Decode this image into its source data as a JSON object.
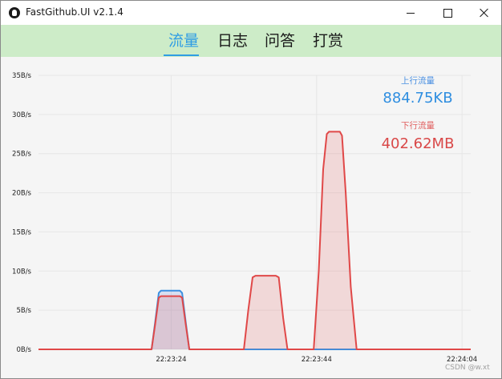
{
  "window": {
    "title": "FastGithub.UI v2.1.4",
    "controls": [
      "minimize",
      "maximize",
      "close"
    ]
  },
  "tabs": [
    {
      "label": "流量",
      "active": true
    },
    {
      "label": "日志",
      "active": false
    },
    {
      "label": "问答",
      "active": false
    },
    {
      "label": "打赏",
      "active": false
    }
  ],
  "stats": {
    "upload_label": "上行流量",
    "upload_value": "884.75KB",
    "download_label": "下行流量",
    "download_value": "402.62MB"
  },
  "colors": {
    "tab_bar": "#cdecc8",
    "active_tab": "#2f9de4",
    "upload": "#3b8fe0",
    "download": "#e04848"
  },
  "chart_data": {
    "type": "area",
    "y_ticks": [
      "0B/s",
      "5B/s",
      "10B/s",
      "15B/s",
      "20B/s",
      "25B/s",
      "30B/s",
      "35B/s"
    ],
    "ylim": [
      0,
      35
    ],
    "x_ticks": [
      "22:23:24",
      "22:23:44",
      "22:24:04"
    ],
    "x_tick_seconds": [
      4,
      24,
      44
    ],
    "xlim": [
      -14.25,
      45.2
    ],
    "grid": true,
    "series": [
      {
        "name": "上行流量",
        "x": [
          -14.25,
          0.5,
          1.3,
          1.8,
          2.3,
          2.6,
          5.2,
          5.5,
          6.0,
          6.5,
          7.0,
          45.2
        ],
        "values": [
          0,
          0,
          0,
          3.5,
          7.2,
          7.5,
          7.5,
          7.2,
          3.5,
          0,
          0,
          0
        ]
      },
      {
        "name": "下行流量",
        "x": [
          -14.25,
          0.5,
          1.3,
          1.8,
          2.3,
          2.6,
          5.2,
          5.5,
          6.0,
          6.5,
          7.0,
          13.5,
          14.0,
          14.6,
          15.2,
          15.6,
          18.4,
          18.8,
          19.4,
          20.0,
          20.5,
          23.0,
          23.6,
          24.3,
          24.9,
          25.4,
          25.7,
          27.2,
          27.5,
          28.0,
          28.7,
          29.5,
          30.2,
          45.2
        ],
        "values": [
          0,
          0,
          0,
          3.2,
          6.6,
          6.8,
          6.8,
          6.6,
          3.2,
          0,
          0,
          0,
          0,
          5.0,
          9.2,
          9.4,
          9.4,
          9.2,
          4.0,
          0,
          0,
          0,
          0,
          10.0,
          23.0,
          27.5,
          27.8,
          27.8,
          27.3,
          20.0,
          8.0,
          0,
          0,
          0
        ]
      }
    ]
  },
  "watermark": "CSDN @w.xt"
}
